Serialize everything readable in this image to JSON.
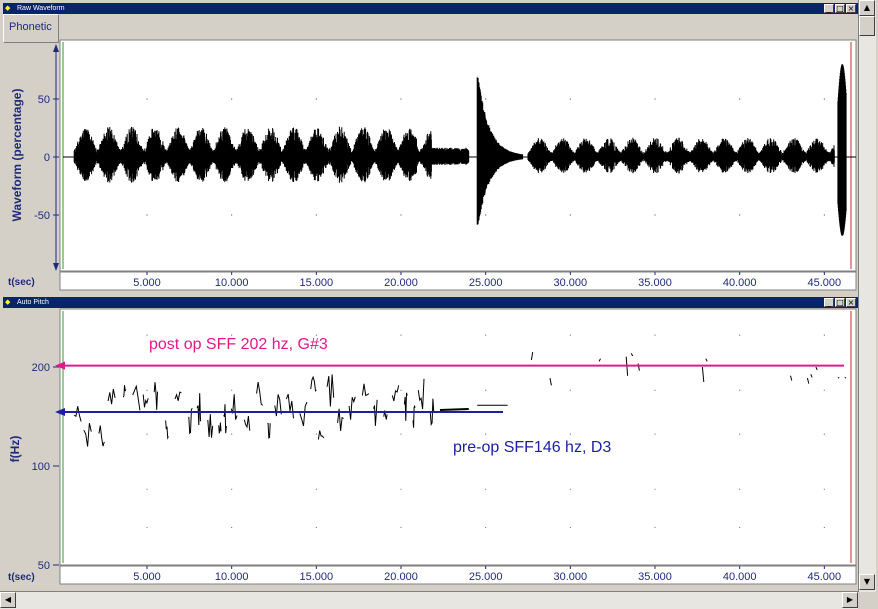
{
  "windows": {
    "waveform": {
      "title": "Raw Waveform",
      "tab": "Phonetic",
      "y_label": "Waveform (percentage)",
      "y_ticks": [
        "50",
        "0",
        "-50"
      ],
      "x_label": "t(sec)",
      "x_ticks": [
        "5.000",
        "10.000",
        "15.000",
        "20.000",
        "25.000",
        "30.000",
        "35.000",
        "40.000",
        "45.000"
      ]
    },
    "pitch": {
      "title": "Auto Pitch",
      "y_label": "f(Hz)",
      "y_ticks": [
        "200",
        "100",
        "50"
      ],
      "x_label": "t(sec)",
      "x_ticks": [
        "5.000",
        "10.000",
        "15.000",
        "20.000",
        "25.000",
        "30.000",
        "35.000",
        "40.000",
        "45.000"
      ],
      "annotation_post": "post op SFF 202 hz, G#3",
      "annotation_pre": "pre-op SFF146 hz, D3"
    }
  },
  "title_buttons": [
    "_",
    "□",
    "×"
  ],
  "colors": {
    "post_line": "#e0188a",
    "pre_line": "#1b1fa0",
    "axis_text": "#1f2a7a",
    "title_bg": "#0a246a"
  },
  "chart_data": [
    {
      "type": "line",
      "title": "Raw Waveform",
      "xlabel": "t(sec)",
      "ylabel": "Waveform (percentage)",
      "xlim": [
        0,
        46.5
      ],
      "ylim": [
        -90,
        90
      ],
      "segments": [
        {
          "t0": 0.7,
          "t1": 21.8,
          "amp": 22,
          "kind": "speech"
        },
        {
          "t0": 21.8,
          "t1": 24.0,
          "amp": 8,
          "kind": "tone"
        },
        {
          "t0": 24.5,
          "t1": 27.2,
          "amp": 75,
          "kind": "decay"
        },
        {
          "t0": 27.5,
          "t1": 45.6,
          "amp": 14,
          "kind": "speech"
        },
        {
          "t0": 45.8,
          "t1": 46.3,
          "amp": 80,
          "kind": "burst"
        }
      ]
    },
    {
      "type": "scatter",
      "title": "Auto Pitch",
      "xlabel": "t(sec)",
      "ylabel": "f(Hz)",
      "xlim": [
        0,
        46.5
      ],
      "ylim": [
        50,
        260
      ],
      "y_scale": "log",
      "reference_lines": [
        {
          "name": "post op SFF 202 hz, G#3",
          "y": 202
        },
        {
          "name": "pre-op SFF146 hz, D3",
          "y": 146
        }
      ],
      "pre_op_range": [
        0.7,
        26.3
      ],
      "post_op_range": [
        27.5,
        46.3
      ]
    }
  ]
}
